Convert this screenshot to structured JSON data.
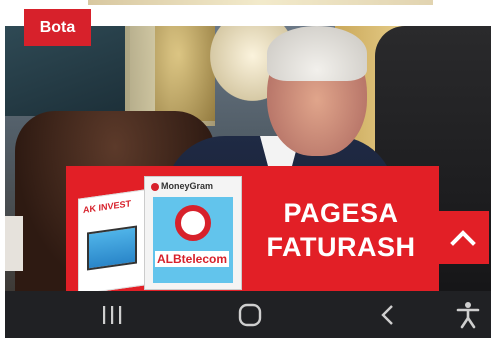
{
  "article": {
    "category_badge": "Bota",
    "image_subject": ""
  },
  "ad_banner": {
    "headline_line1": "PAGESA",
    "headline_line2": "FATURASH",
    "brand_ak": "AK INVEST",
    "brand_moneygram": "MoneyGram",
    "brand_alb": "ALBtelecom",
    "background_color": "#e21f26"
  },
  "scroll_top_button": {
    "icon": "chevron-up-icon",
    "color": "#e21f26"
  },
  "navigation_bar": {
    "recents_icon": "recents-icon",
    "home_icon": "home-icon",
    "back_icon": "back-icon",
    "accessibility_icon": "accessibility-icon",
    "background_color": "#202124"
  }
}
